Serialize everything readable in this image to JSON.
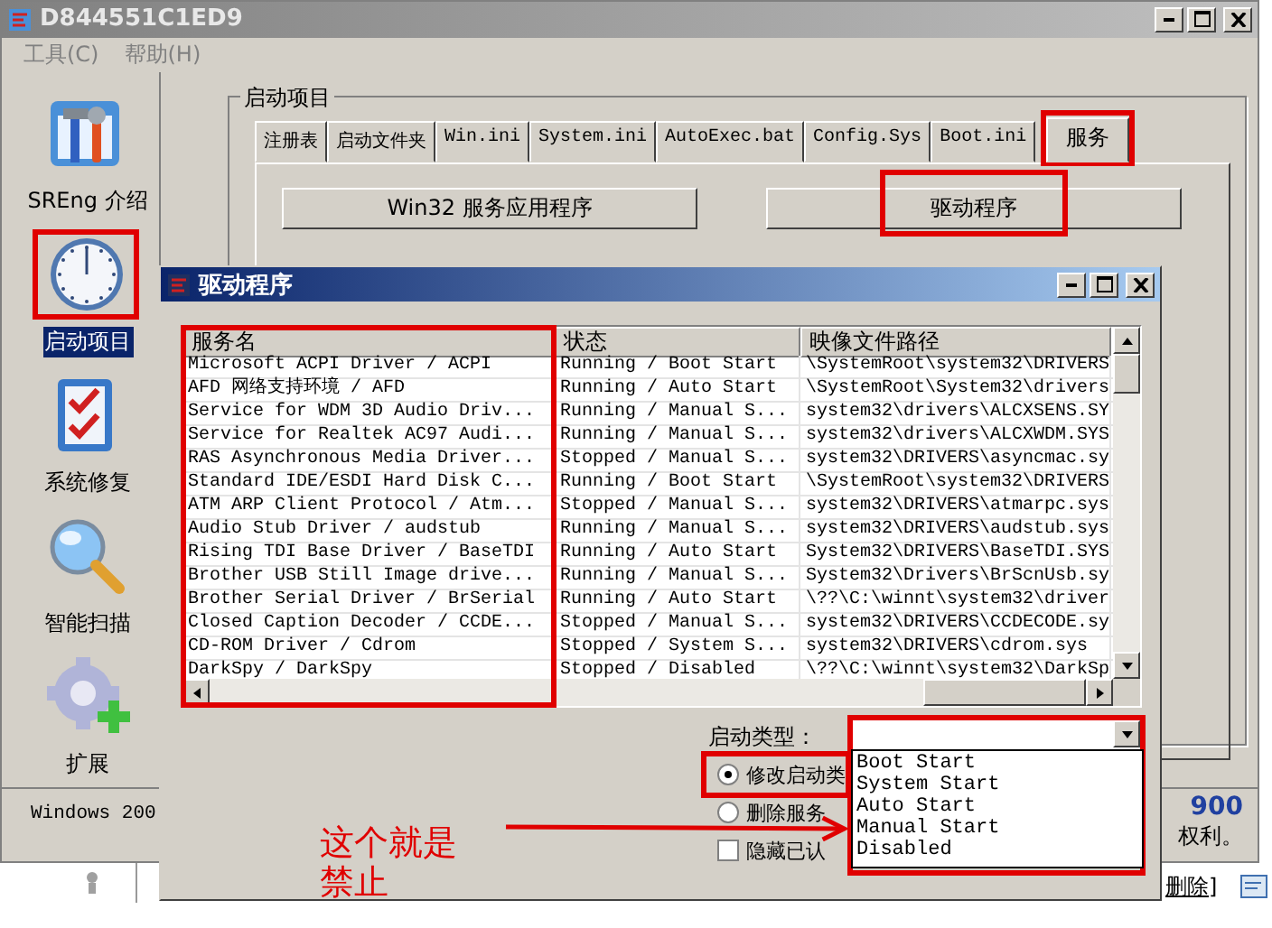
{
  "window": {
    "title": "D844551C1ED9"
  },
  "menu": [
    "工具(C)",
    "帮助(H)"
  ],
  "sidebar": {
    "items": [
      {
        "label": "SREng 介绍",
        "kind": "intro",
        "selected": false
      },
      {
        "label": "启动项目",
        "kind": "startup",
        "selected": true
      },
      {
        "label": "系统修复",
        "kind": "repair",
        "selected": false
      },
      {
        "label": "智能扫描",
        "kind": "scan",
        "selected": false
      },
      {
        "label": "扩展",
        "kind": "extend",
        "selected": false
      }
    ]
  },
  "startup": {
    "group_title": "启动项目",
    "tabs": [
      {
        "label": "注册表",
        "selected": false
      },
      {
        "label": "启动文件夹",
        "selected": false
      },
      {
        "label": "Win.ini",
        "selected": false
      },
      {
        "label": "System.ini",
        "selected": false
      },
      {
        "label": "AutoExec.bat",
        "selected": false
      },
      {
        "label": "Config.Sys",
        "selected": false
      },
      {
        "label": "Boot.ini",
        "selected": false
      },
      {
        "label": "服务",
        "selected": true
      }
    ],
    "buttons": [
      "Win32 服务应用程序",
      "驱动程序"
    ]
  },
  "status_bar": {
    "text": "Windows 200"
  },
  "about": {
    "version": "900",
    "rights": "权利。"
  },
  "background": {
    "link": "删除]"
  },
  "dialog": {
    "title": "驱动程序",
    "table": {
      "columns": [
        "服务名",
        "状态",
        "映像文件路径"
      ],
      "rows": [
        [
          "Microsoft ACPI Driver / ACPI",
          "Running / Boot Start",
          "\\SystemRoot\\system32\\DRIVERS"
        ],
        [
          "AFD 网络支持环境 / AFD",
          "Running / Auto Start",
          "\\SystemRoot\\System32\\drivers"
        ],
        [
          "Service for WDM 3D Audio Driv...",
          "Running / Manual S...",
          "system32\\drivers\\ALCXSENS.SY"
        ],
        [
          "Service for Realtek AC97 Audi...",
          "Running / Manual S...",
          "system32\\drivers\\ALCXWDM.SYS"
        ],
        [
          "RAS Asynchronous Media Driver...",
          "Stopped / Manual S...",
          "system32\\DRIVERS\\asyncmac.sy"
        ],
        [
          "Standard IDE/ESDI Hard Disk C...",
          "Running / Boot Start",
          "\\SystemRoot\\system32\\DRIVERS"
        ],
        [
          "ATM ARP Client Protocol / Atm...",
          "Stopped / Manual S...",
          "system32\\DRIVERS\\atmarpc.sys"
        ],
        [
          "Audio Stub Driver / audstub",
          "Running / Manual S...",
          "system32\\DRIVERS\\audstub.sys"
        ],
        [
          "Rising TDI Base Driver / BaseTDI",
          "Running / Auto Start",
          "System32\\DRIVERS\\BaseTDI.SYS"
        ],
        [
          "Brother USB Still Image drive...",
          "Running / Manual S...",
          "System32\\Drivers\\BrScnUsb.sy"
        ],
        [
          "Brother Serial Driver / BrSerial",
          "Running / Auto Start",
          "\\??\\C:\\winnt\\system32\\driver"
        ],
        [
          "Closed Caption Decoder / CCDE...",
          "Stopped / Manual S...",
          "system32\\DRIVERS\\CCDECODE.sy"
        ],
        [
          "CD-ROM Driver / Cdrom",
          "Stopped / System S...",
          "system32\\DRIVERS\\cdrom.sys"
        ],
        [
          "DarkSpy / DarkSpy",
          "Stopped / Disabled",
          "\\??\\C:\\winnt\\system32\\DarkSp"
        ]
      ]
    },
    "startup_type": {
      "label": "启动类型：",
      "expanded": true,
      "options": [
        "Boot Start",
        "System Start",
        "Auto Start",
        "Manual Start",
        "Disabled"
      ]
    },
    "actions": [
      {
        "kind": "radio",
        "label": "修改启动类",
        "selected": true
      },
      {
        "kind": "radio",
        "label": "删除服务",
        "selected": false
      },
      {
        "kind": "checkbox",
        "label": "隐藏已认",
        "checked": false
      }
    ]
  },
  "annotation": {
    "note": "这个就是禁止"
  }
}
